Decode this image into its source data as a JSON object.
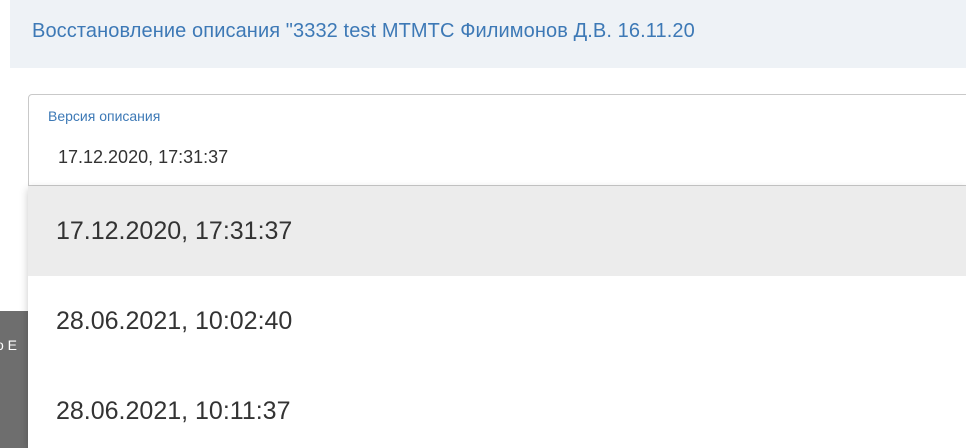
{
  "dialog": {
    "title": "Восстановление описания \"3332 test МТМТС Филимонов Д.В. 16.11.20"
  },
  "background": {
    "partial_text": "о Е"
  },
  "version_select": {
    "label": "Версия описания",
    "value": "17.12.2020, 17:31:37",
    "options": [
      {
        "label": "17.12.2020, 17:31:37",
        "selected": true
      },
      {
        "label": "28.06.2021, 10:02:40",
        "selected": false
      },
      {
        "label": "28.06.2021, 10:11:37",
        "selected": false
      }
    ]
  },
  "colors": {
    "title": "#3d79b6",
    "header_bg": "#eef2f6",
    "selected_option_bg": "#ececec",
    "text": "#333333"
  }
}
